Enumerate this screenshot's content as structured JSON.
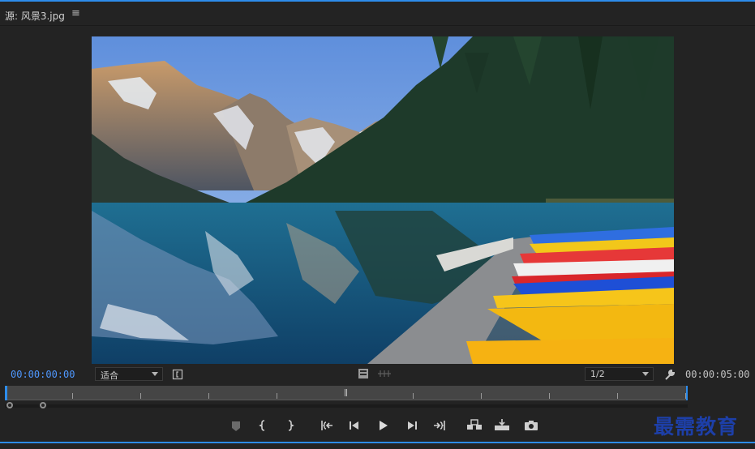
{
  "panel": {
    "title": "源: 风景3.jpg",
    "menu_icon": "hamburger-icon"
  },
  "viewer": {
    "image_subject": "mountain-lake-kayaks"
  },
  "playback": {
    "current_timecode": "00:00:00:00",
    "duration_timecode": "00:00:05:00",
    "zoom_select": "适合",
    "resolution_select": "1/2"
  },
  "controls": [
    "add-marker-icon",
    "mark-in-icon",
    "mark-out-icon",
    "go-to-in-icon",
    "step-back-icon",
    "play-icon",
    "step-forward-icon",
    "go-to-out-icon",
    "insert-icon",
    "overwrite-icon",
    "export-frame-icon"
  ],
  "colors": {
    "accent": "#2d8ceb",
    "timecode": "#4f98ff"
  },
  "watermark": "最需教育"
}
